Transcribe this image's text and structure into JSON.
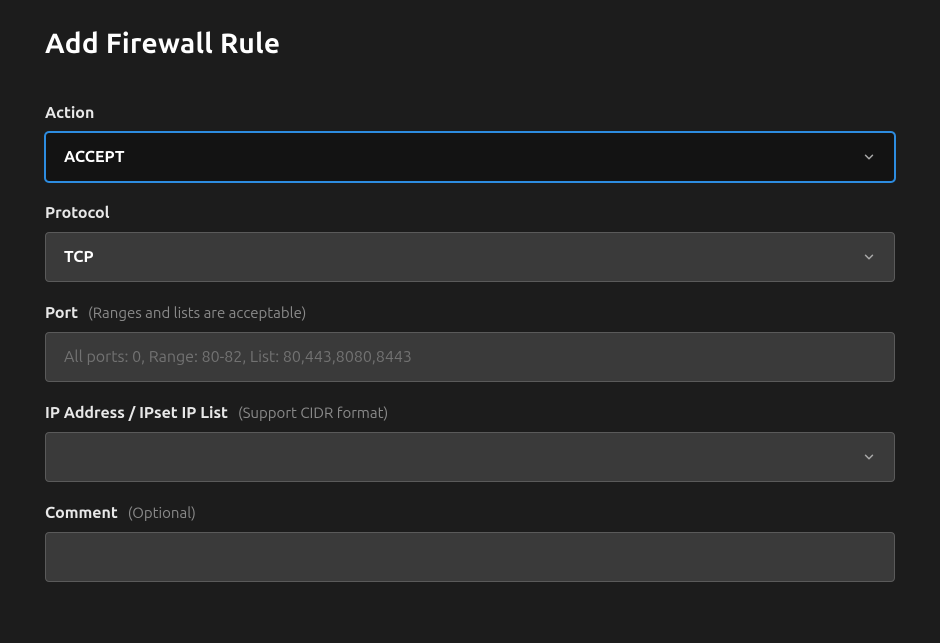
{
  "title": "Add Firewall Rule",
  "action": {
    "label": "Action",
    "value": "ACCEPT"
  },
  "protocol": {
    "label": "Protocol",
    "value": "TCP"
  },
  "port": {
    "label": "Port",
    "hint": "(Ranges and lists are acceptable)",
    "placeholder": "All ports: 0, Range: 80-82, List: 80,443,8080,8443",
    "value": ""
  },
  "ip": {
    "label": "IP Address / IPset IP List",
    "hint": "(Support CIDR format)",
    "value": ""
  },
  "comment": {
    "label": "Comment",
    "hint": "(Optional)",
    "value": ""
  }
}
